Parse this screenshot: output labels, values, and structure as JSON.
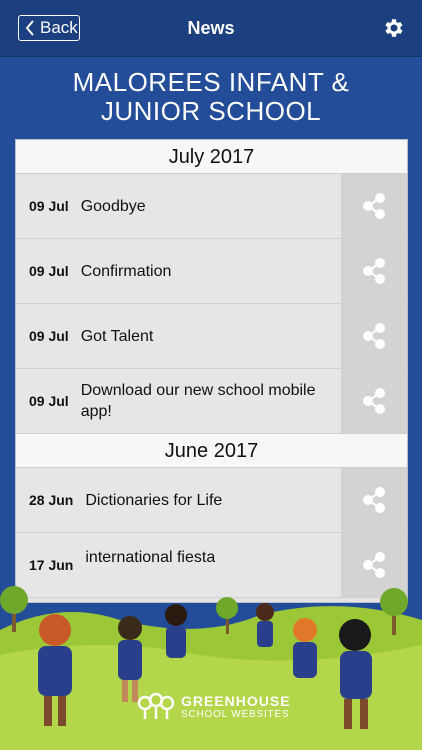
{
  "nav": {
    "back_label": "Back",
    "title": "News",
    "settings_icon": "gear-icon"
  },
  "school": {
    "line1": "MALOREES INFANT &",
    "line2": "JUNIOR SCHOOL"
  },
  "sections": [
    {
      "month": "July 2017",
      "items": [
        {
          "date": "09 Jul",
          "title": "Goodbye"
        },
        {
          "date": "09 Jul",
          "title": "Confirmation"
        },
        {
          "date": "09 Jul",
          "title": "Got Talent"
        },
        {
          "date": "09 Jul",
          "title": "Download our new school mobile app!"
        }
      ]
    },
    {
      "month": "June 2017",
      "items": [
        {
          "date": "28 Jun",
          "title": "Dictionaries for Life"
        },
        {
          "date": "17 Jun",
          "title": "international fiesta"
        }
      ]
    }
  ],
  "footer": {
    "brand_line1": "GREENHOUSE",
    "brand_line2": "SCHOOL WEBSITES"
  },
  "colors": {
    "nav_bg": "#1c3f80",
    "page_bg": "#234d98",
    "row_bg": "#e6e6e6",
    "share_bg": "#d3d3d3",
    "grass": "#9cc838"
  }
}
